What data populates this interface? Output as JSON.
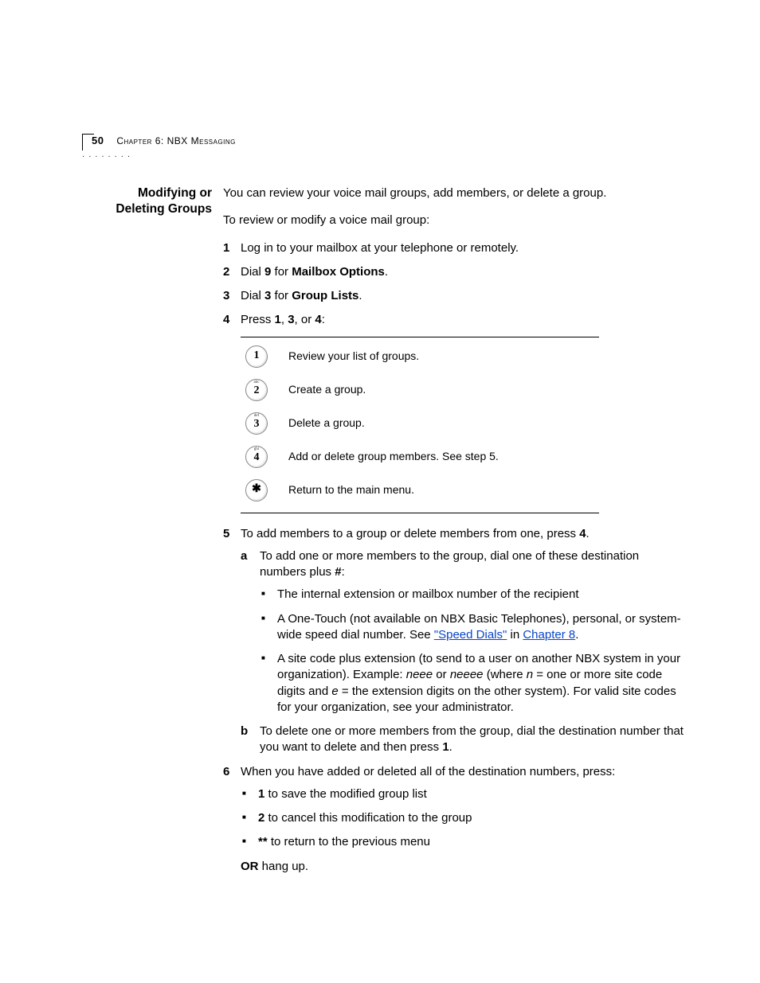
{
  "header": {
    "page_number": "50",
    "chapter_label": "Chapter 6: NBX Messaging"
  },
  "section": {
    "title_line1": "Modifying or",
    "title_line2": "Deleting Groups"
  },
  "intro": {
    "para1": "You can review your voice mail groups, add members, or delete a group.",
    "para2": "To review or modify a voice mail group:"
  },
  "steps": {
    "s1": "Log in to your mailbox at your telephone or remotely.",
    "s2_pre": "Dial ",
    "s2_key": "9",
    "s2_mid": " for ",
    "s2_bold": "Mailbox Options",
    "s2_end": ".",
    "s3_pre": "Dial ",
    "s3_key": "3",
    "s3_mid": " for ",
    "s3_bold": "Group Lists",
    "s3_end": ".",
    "s4_pre": "Press ",
    "s4_k1": "1",
    "s4_c1": ", ",
    "s4_k2": "3",
    "s4_c2": ", or ",
    "s4_k3": "4",
    "s4_end": ":",
    "s5_pre": "To add members to a group or delete members from one, press ",
    "s5_key": "4",
    "s5_end": ".",
    "s6": "When you have added or deleted all of the destination numbers, press:"
  },
  "keytable": {
    "k1": {
      "digit": "1",
      "letters": "",
      "desc": "Review your list of groups."
    },
    "k2": {
      "digit": "2",
      "letters": "abc",
      "desc": "Create a group."
    },
    "k3": {
      "digit": "3",
      "letters": "def",
      "desc": "Delete a group."
    },
    "k4": {
      "digit": "4",
      "letters": "ghi",
      "desc": "Add or delete group members. See step 5."
    },
    "k5": {
      "digit": "✱",
      "letters": "",
      "desc": "Return to the main menu."
    }
  },
  "sub5": {
    "a_pre": "To add one or more members to the group, dial one of these destination numbers plus ",
    "a_bold": "#",
    "a_end": ":",
    "a_b1": "The internal extension or mailbox number of the recipient",
    "a_b2_pre": "A One-Touch (not available on NBX Basic Telephones), personal, or system-wide speed dial number. See ",
    "a_b2_link1": "\"Speed Dials\"",
    "a_b2_mid": " in ",
    "a_b2_link2": "Chapter 8",
    "a_b2_end": ".",
    "a_b3_pre": "A site code plus extension (to send to a user on another NBX system in your organization). Example: ",
    "a_b3_i1": "neee",
    "a_b3_or": " or ",
    "a_b3_i2": "neeee",
    "a_b3_where": " (where ",
    "a_b3_n": "n",
    "a_b3_neq": " = one or more site code digits and ",
    "a_b3_e": "e",
    "a_b3_eeq": " = the extension digits on the other system). For valid site codes for your organization, see your administrator.",
    "b_pre": "To delete one or more members from the group, dial the destination number that you want to delete and then press ",
    "b_key": "1",
    "b_end": "."
  },
  "sub6": {
    "b1_key": "1",
    "b1_txt": " to save the modified group list",
    "b2_key": "2",
    "b2_txt": " to cancel this modification to the group",
    "b3_key": "**",
    "b3_txt": " to return to the previous menu",
    "or_bold": "OR",
    "or_txt": " hang up."
  }
}
